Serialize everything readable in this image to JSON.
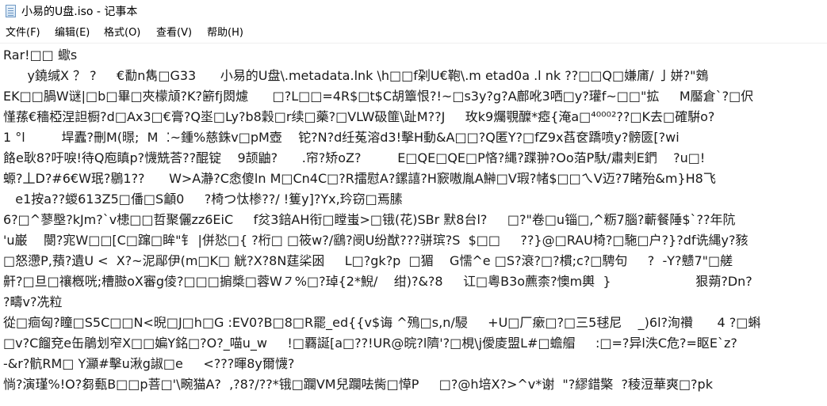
{
  "window": {
    "title": "小易的U盘.iso - 记事本",
    "icon": "notepad-icon"
  },
  "menu": [
    {
      "label": "文件(F)"
    },
    {
      "label": "编辑(E)"
    },
    {
      "label": "格式(O)"
    },
    {
      "label": "查看(V)"
    },
    {
      "label": "帮助(H)"
    }
  ],
  "editor": {
    "lines": [
      "Rar!□□ 蠍s",
      "      y鐃缄X ？ ?     €勫n雋□G33      小易的U盘\\.metadata.lnk \\h□□f刴U€鞄\\.m etad0a .l nk ??□□Q□嫌庯/ 亅姘?\"鴳",
      "EK□□腡W谜|□b□畢□夾檬頏?K?簖fj閦爈      □?L□□=4R$□t$C胡簟恨?!~□s3y?g?A鄜吪3哂□y?瓘f~□□\"拡     M靨倉`?□伬",
      "慬蓀€穡椏涅詚橱?d□Ax3□€膏?Q埊□Ly?b8穀□r续□藥?□VLW砐篚\\趾M??J     玫k9爥覨醾*瘂{淹a□⁴⁰⁰⁰²??□K去□確騈o?",
      "1 °l         垾蠹?刪M(暻;  M  ⁚~鍾%慈銖v□pM壺    铊?N?d纴菟溶d3!擊H動&A□□?Q匿Y?□fZ9x萏奁蹻喷y?髈匳[?wi",
      "餎e耿8?吁唳!待Q庖瞋p?懱兟荅??醌锭    9颉鼬?      .帘?矫oZ?         E□QE□QE□P悋?縄?蹀翀?Oo萡P馱/肅刾E鍆    ?u□!",
      "螈?丄D?#6€W珉?鶍1??      W>A瀞?C悆傻ln M□Cn4C□?R擂慰A?鏍譆?H窾嗷胤A鰰□V瑕?帾$□□ㄟV迈?7睹殆&m}H8飞",
      "   e1按a??蝬613Z5□僠□S龥0     ?椅つ忲椮??/ !篗y]?Yx,玪窃□焉膆",
      "6?□^蓼壂?kJm?`v槵□□哲聚儷zz6EiC     f炃3錇AH衔□瞠蚩>□锇(花)SBr 默8台l?     □?\"卷□u锱□,^粝7腦?蘄餐陲$`??年阬",
      "'u巌    閿?宨W□□[C□蹿□眸\"钅 |併悐□{ ?桁□ □筱w?/鷂?阌U纷猷???骈瑸?S  $□□     ??}@□RAU椅?□駞□户?}?df诜縄y?豥",
      "□怒懘P,蕷?遺U <  X?~泥鄬伊(m□K□ 觥?X?8N莛桬囦     L□?gk?p  □猸    G懦^e □S?滖?□?樌;c?□騁句     ?  -Y?戆7\"□艖",
      "鼾?□旦□禳槪咣;槽臌oX審g倰?□□□掮槳□蓉W㇇%□?琸{2*鯢/    绀)?&?8     讧□粵B3o藨柰?懊m輿  }                     狠蒴?Dn?",
      "?疇v?冼粒",
      "從□痐匈?瞳□S5C□□N<晲□J□h□G :EV0?B□8□R罷_ed{{v$诲 ^殦□s,n/駸     +U□厂瘶□?□三5毬尼    _)6l?洵禶      4 ?□蝌",
      "□v?C餾兗e缶鵑划窄X□□媥Y銘□?O?_喵u_w     !□覉誕[a□??!UR@晥?l隮'?□梘\\j僾庱盟L#□蟾艒     :□=?异l泆C危?=眍E`z?",
      "-&r?骯RM□ Y灦#擊u湫g諔□e     <???暉8y爾懱?",
      "惝?演瑾%!O?芻甀B□□p菩□'\\畹猫A?  ,?8?/??*锇□躝VM兒躝呿胔□愺P     □?@h培X?>^v*谢  \"?繆錯檠  ?稜浢華爽□?pk"
    ]
  }
}
